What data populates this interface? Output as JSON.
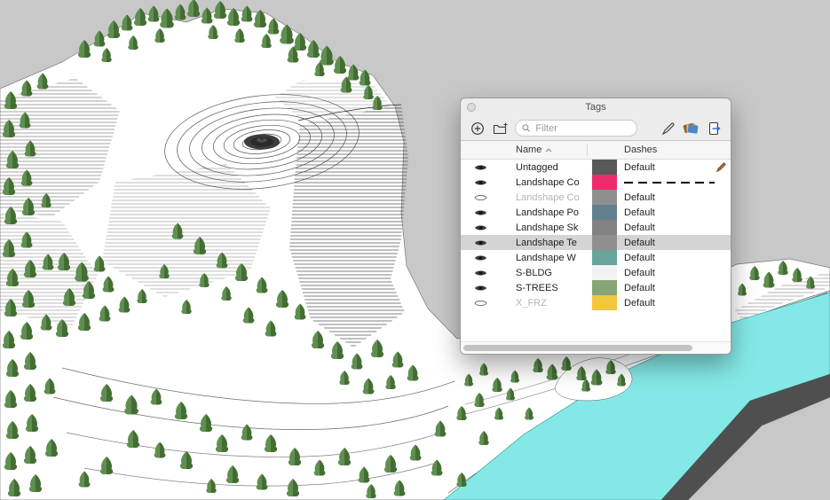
{
  "colors": {
    "bg": "#c8c8c8",
    "terrain": "#ffffff",
    "contour": "#2b2b2b",
    "tree": "#5f8f50",
    "tree_dark": "#3f672f",
    "water": "#84e9e6",
    "side": "#4f4f4f"
  },
  "tags_panel": {
    "title": "Tags",
    "filter_placeholder": "Filter",
    "columns": {
      "name": "Name",
      "dashes": "Dashes"
    },
    "rows": [
      {
        "name": "Untagged",
        "visible": true,
        "color": "#595959",
        "dashes": "Default",
        "dashed": false,
        "muted": false,
        "selected": false,
        "current": true
      },
      {
        "name": "Landshape Co",
        "visible": true,
        "color": "#ee2b6c",
        "dashes": "",
        "dashed": true,
        "muted": false,
        "selected": false,
        "current": false
      },
      {
        "name": "Landshape Co",
        "visible": false,
        "color": "#8f8f8f",
        "dashes": "Default",
        "dashed": false,
        "muted": true,
        "selected": false,
        "current": false
      },
      {
        "name": "Landshape Po",
        "visible": true,
        "color": "#62808f",
        "dashes": "Default",
        "dashed": false,
        "muted": false,
        "selected": false,
        "current": false
      },
      {
        "name": "Landshape Sk",
        "visible": true,
        "color": "#828282",
        "dashes": "Default",
        "dashed": false,
        "muted": false,
        "selected": false,
        "current": false
      },
      {
        "name": "Landshape Te",
        "visible": true,
        "color": "#8f8f8f",
        "dashes": "Default",
        "dashed": false,
        "muted": false,
        "selected": true,
        "current": false
      },
      {
        "name": "Landshape W",
        "visible": true,
        "color": "#68a49c",
        "dashes": "Default",
        "dashed": false,
        "muted": false,
        "selected": false,
        "current": false
      },
      {
        "name": "S-BLDG",
        "visible": true,
        "color": "#f2f2f2",
        "dashes": "Default",
        "dashed": false,
        "muted": false,
        "selected": false,
        "current": false
      },
      {
        "name": "S-TREES",
        "visible": true,
        "color": "#87a575",
        "dashes": "Default",
        "dashed": false,
        "muted": false,
        "selected": false,
        "current": false
      },
      {
        "name": "X_FRZ",
        "visible": false,
        "color": "#f2c63e",
        "dashes": "Default",
        "dashed": false,
        "muted": true,
        "selected": false,
        "current": false
      }
    ]
  }
}
